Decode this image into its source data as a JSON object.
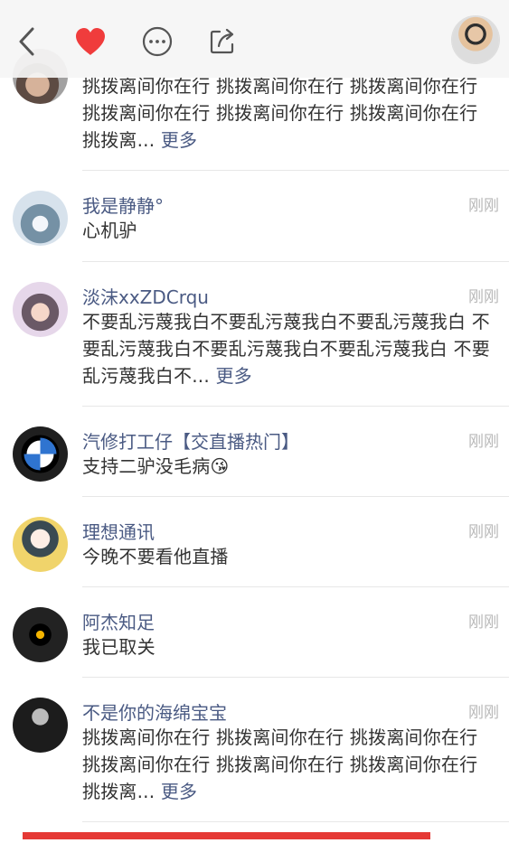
{
  "top_bar": {
    "icons": [
      "back-icon",
      "heart-icon",
      "more-icon",
      "share-icon"
    ],
    "heart_color": "#f03c3c"
  },
  "comments": [
    {
      "name": "",
      "time": "",
      "text": "挑拨离间你在行 挑拨离间你在行 挑拨离间你在行 挑拨离间你在行 挑拨离间你在行 挑拨离间你在行 挑拨离...",
      "more": "更多"
    },
    {
      "name": "我是静静°",
      "time": "刚刚",
      "text": "心机驴",
      "more": ""
    },
    {
      "name": "淡沫xxZDCrqu",
      "time": "刚刚",
      "text": "不要乱污蔑我白不要乱污蔑我白不要乱污蔑我白 不要乱污蔑我白不要乱污蔑我白不要乱污蔑我白 不要乱污蔑我白不...",
      "more": "更多"
    },
    {
      "name": "汽修打工仔【交直播热门】",
      "time": "刚刚",
      "text": "支持二驴没毛病😘",
      "more": ""
    },
    {
      "name": "理想通讯",
      "time": "刚刚",
      "text": "今晚不要看他直播",
      "more": ""
    },
    {
      "name": "阿杰知足",
      "time": "刚刚",
      "text": "我已取关",
      "more": ""
    },
    {
      "name": "不是你的海绵宝宝",
      "time": "刚刚",
      "text": "挑拨离间你在行 挑拨离间你在行 挑拨离间你在行 挑拨离间你在行 挑拨离间你在行 挑拨离间你在行 挑拨离...",
      "more": "更多"
    }
  ]
}
